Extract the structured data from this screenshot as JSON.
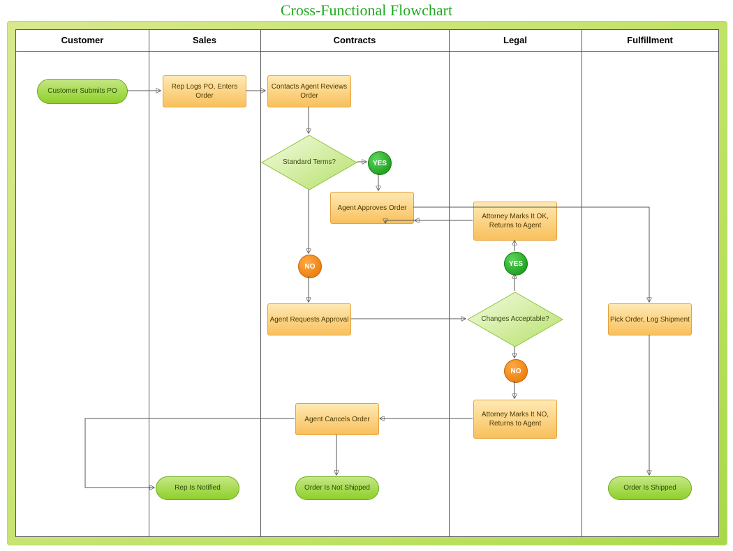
{
  "title": "Cross-Functional Flowchart",
  "lanes": {
    "customer": "Customer",
    "sales": "Sales",
    "contracts": "Contracts",
    "legal": "Legal",
    "fulfillment": "Fulfillment"
  },
  "nodes": {
    "customer_submits": "Customer Submits PO",
    "rep_logs": "Rep Logs PO, Enters Order",
    "contacts_agent": "Contacts Agent Reviews Order",
    "standard_terms": "Standard Terms?",
    "agent_approves": "Agent Approves Order",
    "agent_requests": "Agent Requests Approval",
    "attorney_ok": "Attorney Marks It OK, Returns to Agent",
    "changes_acceptable": "Changes Acceptable?",
    "attorney_no": "Attorney Marks It NO, Returns to Agent",
    "agent_cancels": "Agent Cancels Order",
    "rep_notified": "Rep Is Notified",
    "order_not_shipped": "Order Is Not Shipped",
    "pick_order": "Pick Order, Log Shipment",
    "order_shipped": "Order Is Shipped"
  },
  "badges": {
    "yes": "YES",
    "no": "NO"
  }
}
